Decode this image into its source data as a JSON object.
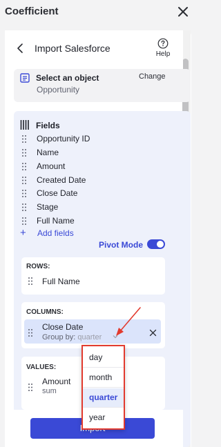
{
  "app": {
    "title": "Coefficient"
  },
  "header": {
    "title": "Import Salesforce",
    "help_label": "Help"
  },
  "object": {
    "title": "Select an object",
    "value": "Opportunity",
    "change_label": "Change"
  },
  "fields": {
    "title": "Fields",
    "items": [
      "Opportunity ID",
      "Name",
      "Amount",
      "Created Date",
      "Close Date",
      "Stage",
      "Full Name"
    ],
    "add_label": "Add fields",
    "add_glyph": "+",
    "pivot_label": "Pivot Mode",
    "pivot_on": true
  },
  "rows": {
    "title": "ROWS:",
    "items": [
      "Full Name"
    ]
  },
  "columns": {
    "title": "COLUMNS:",
    "chip": {
      "label": "Close Date",
      "group_label": "Group by:",
      "group_value": "quarter"
    }
  },
  "values": {
    "title": "VALUES:",
    "item": {
      "label": "Amount",
      "aggregation": "sum"
    }
  },
  "dropdown": {
    "options": [
      "day",
      "month",
      "quarter",
      "year"
    ],
    "selected": "quarter"
  },
  "footer": {
    "import_label": "Import"
  },
  "colors": {
    "accent": "#3a49d6",
    "highlight_border": "#e23a2e",
    "panel_tint": "#eef1fb"
  }
}
